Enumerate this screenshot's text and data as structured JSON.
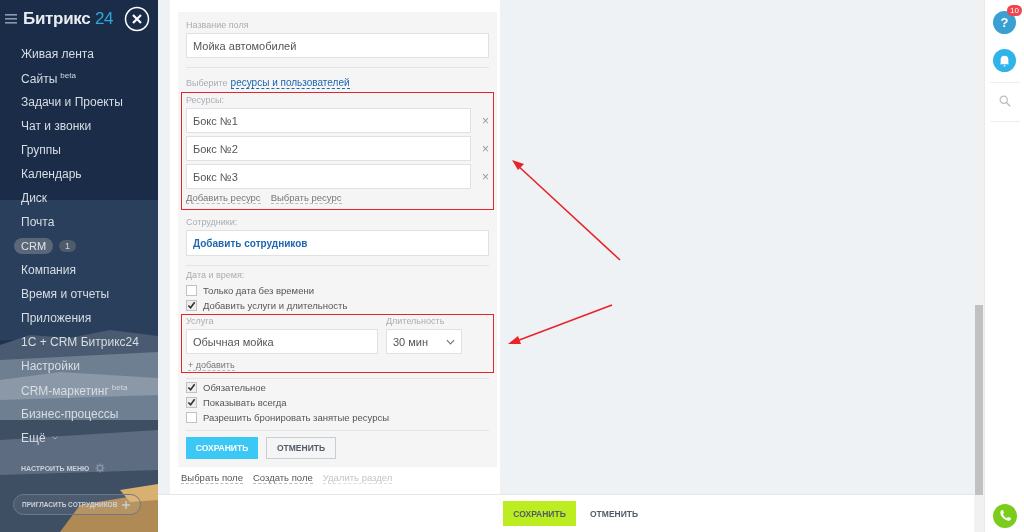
{
  "sidebar": {
    "logo": {
      "name": "Битрикс",
      "suffix": "24"
    },
    "items": [
      {
        "kind": "link",
        "label": "Живая лента"
      },
      {
        "kind": "link",
        "label": "Сайты",
        "sup": "beta"
      },
      {
        "kind": "link",
        "label": "Задачи и Проекты"
      },
      {
        "kind": "link",
        "label": "Чат и звонки"
      },
      {
        "kind": "link",
        "label": "Группы"
      },
      {
        "kind": "link",
        "label": "Календарь"
      },
      {
        "kind": "link",
        "label": "Диск"
      },
      {
        "kind": "link",
        "label": "Почта"
      },
      {
        "kind": "pill",
        "label": "CRM",
        "badge": "1"
      },
      {
        "kind": "link",
        "label": "Компания"
      },
      {
        "kind": "link",
        "label": "Время и отчеты"
      },
      {
        "kind": "link",
        "label": "Приложения"
      },
      {
        "kind": "link",
        "label": "1С + CRM Битрикс24"
      },
      {
        "kind": "link",
        "label": "Настройки"
      },
      {
        "kind": "link",
        "label": "CRM-маркетинг",
        "sup": "beta"
      },
      {
        "kind": "link",
        "label": "Бизнес-процессы"
      },
      {
        "kind": "more",
        "label": "Ещё"
      }
    ],
    "configure": "НАСТРОИТЬ МЕНЮ",
    "invite": "ПРИГЛАСИТЬ СОТРУДНИКОВ"
  },
  "form": {
    "name_label": "Название поля",
    "name_value": "Мойка автомобилей",
    "choose_prefix": "Выберите",
    "choose_link": "ресурсы и пользователей",
    "resources_label": "Ресурсы:",
    "resources": [
      {
        "value": "Бокс №1",
        "remove": "×"
      },
      {
        "value": "Бокс №2",
        "remove": "×"
      },
      {
        "value": "Бокс №3",
        "remove": "×"
      }
    ],
    "resource_links": [
      "Добавить ресурс",
      "Выбрать ресурс"
    ],
    "staff_label": "Сотрудники:",
    "staff_link": "Добавить сотрудников",
    "datetime_label": "Дата и время:",
    "datetime_options": [
      {
        "label": "Только дата без времени",
        "checked": false
      },
      {
        "label": "Добавить услуги и длительность",
        "checked": true
      }
    ],
    "service_label": "Услуга",
    "duration_label": "Длительность",
    "service_value": "Обычная мойка",
    "duration_value": "30 мин",
    "add_link": "+ добавить",
    "options": [
      {
        "label": "Обязательное",
        "checked": true
      },
      {
        "label": "Показывать всегда",
        "checked": true
      },
      {
        "label": "Разрешить бронировать занятые ресурсы",
        "checked": false
      }
    ],
    "save": "СОХРАНИТЬ",
    "cancel": "ОТМЕНИТЬ",
    "footer_links": [
      {
        "label": "Выбрать поле",
        "disabled": false
      },
      {
        "label": "Создать поле",
        "disabled": false
      },
      {
        "label": "Удалить раздел",
        "disabled": true
      }
    ]
  },
  "bottom_bar": {
    "save": "СОХРАНИТЬ",
    "cancel": "ОТМЕНИТЬ"
  },
  "right_bar": {
    "help": "?",
    "help_badge": "10"
  }
}
